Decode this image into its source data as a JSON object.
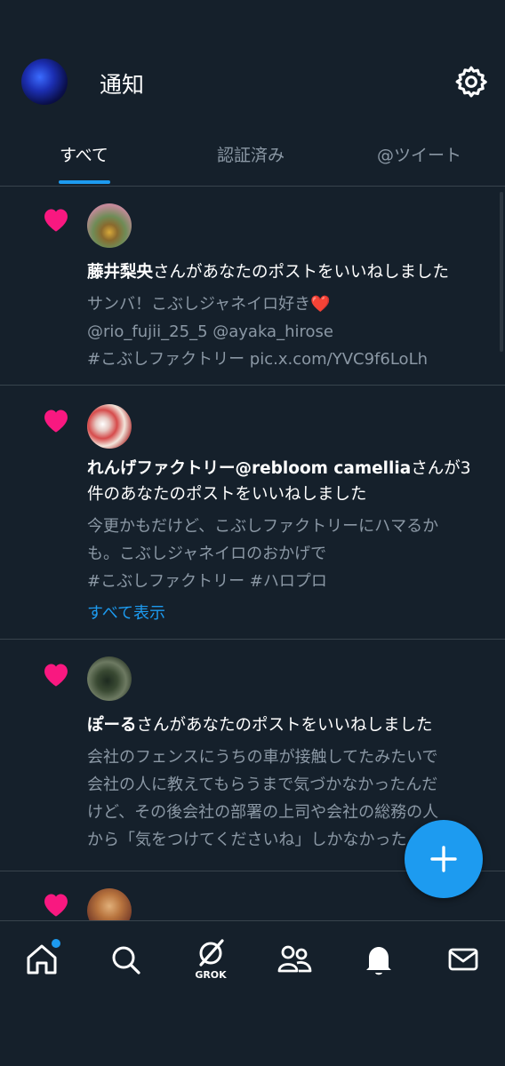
{
  "header": {
    "title": "通知"
  },
  "tabs": [
    {
      "label": "すべて",
      "active": true
    },
    {
      "label": "認証済み",
      "active": false
    },
    {
      "label": "@ツイート",
      "active": false
    }
  ],
  "notifications": [
    {
      "user": "藤井梨央",
      "action": "さんがあなたのポストをいいねしました",
      "lines": [
        "サンバ！こぶしジャネイロ好き❤️",
        "@rio_fujii_25_5 @ayaka_hirose",
        "#こぶしファクトリー pic.x.com/YVC9f6LoLh"
      ]
    },
    {
      "user": "れんげファクトリー@rebloom camellia",
      "action": "さんが3件のあなたのポストをいいねしました",
      "action_line1": "さんが3",
      "action_line2": "件のあなたのポストをいいねしました",
      "lines": [
        "今更かもだけど、こぶしファクトリーにハマるか",
        "も。こぶしジャネイロのおかげで",
        "#こぶしファクトリー #ハロプロ"
      ],
      "show_all": "すべて表示"
    },
    {
      "user": "ぽーる",
      "action": "さんがあなたのポストをいいねしました",
      "lines": [
        "会社のフェンスにうちの車が接触してたみたいで",
        "会社の人に教えてもらうまで気づかなかったんだ",
        "けど、その後会社の部署の上司や会社の総務の人",
        "から「気をつけてくださいね」しかなかった"
      ]
    }
  ],
  "bottom_nav": {
    "items": [
      "home",
      "search",
      "grok",
      "communities",
      "notifications",
      "messages"
    ],
    "grok_label": "GROK"
  },
  "colors": {
    "background": "#15202b",
    "accent": "#1d9bf0",
    "heart": "#f91880",
    "muted": "#8b98a5"
  },
  "icons": [
    "gear-icon",
    "heart-icon",
    "plus-icon",
    "home-icon",
    "search-icon",
    "grok-icon",
    "communities-icon",
    "bell-icon",
    "mail-icon"
  ]
}
